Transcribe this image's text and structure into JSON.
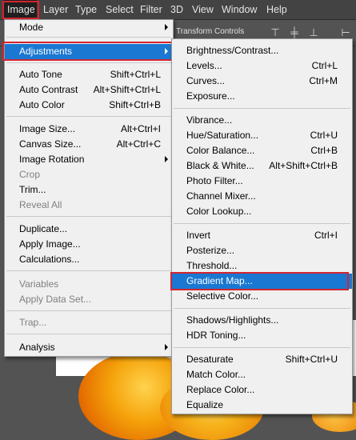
{
  "menubar": {
    "items": [
      "Image",
      "Layer",
      "Type",
      "Select",
      "Filter",
      "3D",
      "View",
      "Window",
      "Help"
    ]
  },
  "options_bar": {
    "transform_controls_label": "Transform Controls"
  },
  "image_menu": {
    "mode": "Mode",
    "adjustments": "Adjustments",
    "auto_tone": {
      "label": "Auto Tone",
      "shortcut": "Shift+Ctrl+L"
    },
    "auto_contrast": {
      "label": "Auto Contrast",
      "shortcut": "Alt+Shift+Ctrl+L"
    },
    "auto_color": {
      "label": "Auto Color",
      "shortcut": "Shift+Ctrl+B"
    },
    "image_size": {
      "label": "Image Size...",
      "shortcut": "Alt+Ctrl+I"
    },
    "canvas_size": {
      "label": "Canvas Size...",
      "shortcut": "Alt+Ctrl+C"
    },
    "image_rotation": "Image Rotation",
    "crop": "Crop",
    "trim": "Trim...",
    "reveal_all": "Reveal All",
    "duplicate": "Duplicate...",
    "apply_image": "Apply Image...",
    "calculations": "Calculations...",
    "variables": "Variables",
    "apply_data_set": "Apply Data Set...",
    "trap": "Trap...",
    "analysis": "Analysis"
  },
  "adjustments_menu": {
    "brightness_contrast": {
      "label": "Brightness/Contrast...",
      "shortcut": ""
    },
    "levels": {
      "label": "Levels...",
      "shortcut": "Ctrl+L"
    },
    "curves": {
      "label": "Curves...",
      "shortcut": "Ctrl+M"
    },
    "exposure": {
      "label": "Exposure...",
      "shortcut": ""
    },
    "vibrance": {
      "label": "Vibrance...",
      "shortcut": ""
    },
    "hue_saturation": {
      "label": "Hue/Saturation...",
      "shortcut": "Ctrl+U"
    },
    "color_balance": {
      "label": "Color Balance...",
      "shortcut": "Ctrl+B"
    },
    "black_white": {
      "label": "Black & White...",
      "shortcut": "Alt+Shift+Ctrl+B"
    },
    "photo_filter": {
      "label": "Photo Filter...",
      "shortcut": ""
    },
    "channel_mixer": {
      "label": "Channel Mixer...",
      "shortcut": ""
    },
    "color_lookup": {
      "label": "Color Lookup...",
      "shortcut": ""
    },
    "invert": {
      "label": "Invert",
      "shortcut": "Ctrl+I"
    },
    "posterize": {
      "label": "Posterize...",
      "shortcut": ""
    },
    "threshold": {
      "label": "Threshold...",
      "shortcut": ""
    },
    "gradient_map": {
      "label": "Gradient Map...",
      "shortcut": ""
    },
    "selective_color": {
      "label": "Selective Color...",
      "shortcut": ""
    },
    "shadows_highlights": {
      "label": "Shadows/Highlights...",
      "shortcut": ""
    },
    "hdr_toning": {
      "label": "HDR Toning...",
      "shortcut": ""
    },
    "desaturate": {
      "label": "Desaturate",
      "shortcut": "Shift+Ctrl+U"
    },
    "match_color": {
      "label": "Match Color...",
      "shortcut": ""
    },
    "replace_color": {
      "label": "Replace Color...",
      "shortcut": ""
    },
    "equalize": {
      "label": "Equalize",
      "shortcut": ""
    }
  },
  "colors": {
    "highlight": "#1a78d2",
    "callout_red": "#d4242f",
    "menu_bg": "#f0f0f0",
    "app_chrome": "#434343"
  }
}
